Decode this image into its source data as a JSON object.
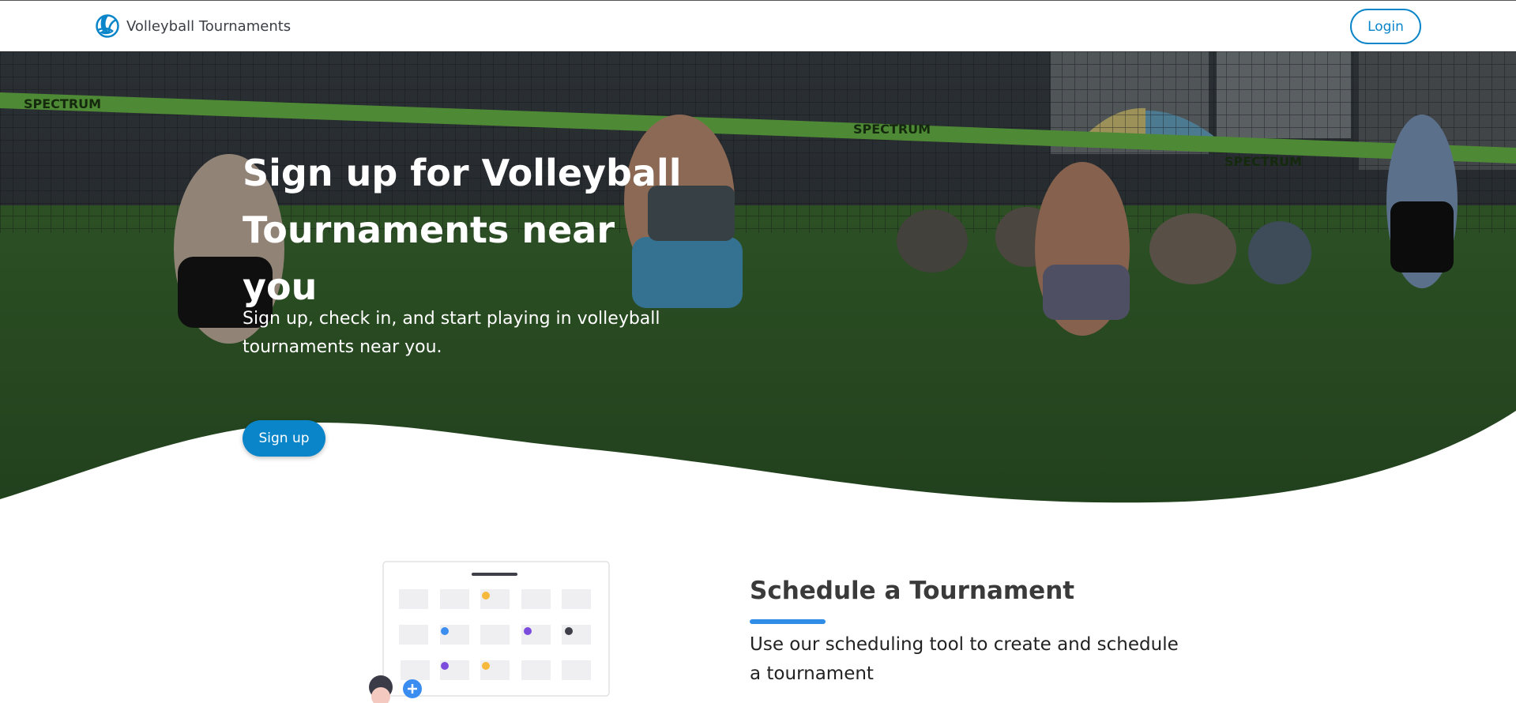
{
  "header": {
    "brand_name": "Volleyball Tournaments",
    "login_label": "Login"
  },
  "hero": {
    "title": "Sign up for Volleyball Tournaments near you",
    "subtitle": "Sign up, check in, and start playing in volleyball tournaments near you.",
    "signup_label": "Sign up",
    "net_banner_text": "SPECTRUM"
  },
  "feature": {
    "title": "Schedule a Tournament",
    "text": "Use our scheduling tool to create and schedule a tournament"
  },
  "colors": {
    "accent": "#0a85c9",
    "underline": "#2f8de8",
    "grass": "#3f7a35"
  }
}
